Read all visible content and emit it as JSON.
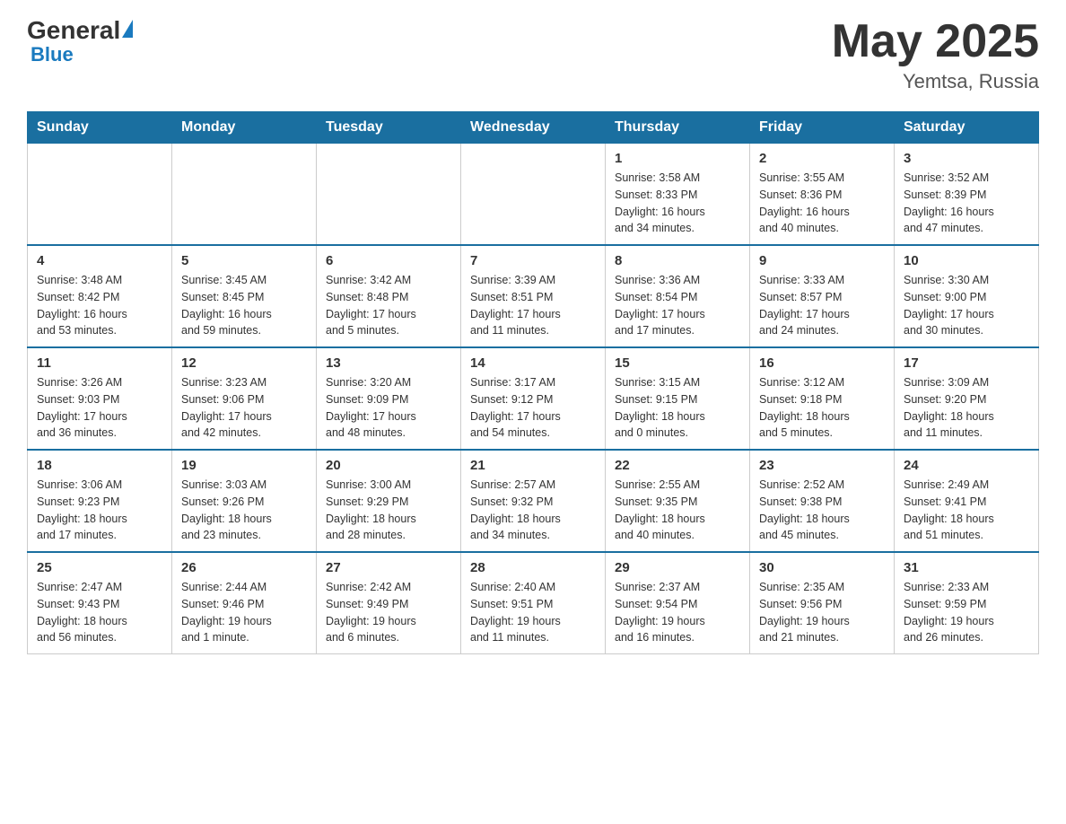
{
  "header": {
    "logo_general": "General",
    "logo_blue": "Blue",
    "month_year": "May 2025",
    "location": "Yemtsa, Russia"
  },
  "days_of_week": [
    "Sunday",
    "Monday",
    "Tuesday",
    "Wednesday",
    "Thursday",
    "Friday",
    "Saturday"
  ],
  "weeks": [
    [
      {
        "day": "",
        "info": ""
      },
      {
        "day": "",
        "info": ""
      },
      {
        "day": "",
        "info": ""
      },
      {
        "day": "",
        "info": ""
      },
      {
        "day": "1",
        "info": "Sunrise: 3:58 AM\nSunset: 8:33 PM\nDaylight: 16 hours\nand 34 minutes."
      },
      {
        "day": "2",
        "info": "Sunrise: 3:55 AM\nSunset: 8:36 PM\nDaylight: 16 hours\nand 40 minutes."
      },
      {
        "day": "3",
        "info": "Sunrise: 3:52 AM\nSunset: 8:39 PM\nDaylight: 16 hours\nand 47 minutes."
      }
    ],
    [
      {
        "day": "4",
        "info": "Sunrise: 3:48 AM\nSunset: 8:42 PM\nDaylight: 16 hours\nand 53 minutes."
      },
      {
        "day": "5",
        "info": "Sunrise: 3:45 AM\nSunset: 8:45 PM\nDaylight: 16 hours\nand 59 minutes."
      },
      {
        "day": "6",
        "info": "Sunrise: 3:42 AM\nSunset: 8:48 PM\nDaylight: 17 hours\nand 5 minutes."
      },
      {
        "day": "7",
        "info": "Sunrise: 3:39 AM\nSunset: 8:51 PM\nDaylight: 17 hours\nand 11 minutes."
      },
      {
        "day": "8",
        "info": "Sunrise: 3:36 AM\nSunset: 8:54 PM\nDaylight: 17 hours\nand 17 minutes."
      },
      {
        "day": "9",
        "info": "Sunrise: 3:33 AM\nSunset: 8:57 PM\nDaylight: 17 hours\nand 24 minutes."
      },
      {
        "day": "10",
        "info": "Sunrise: 3:30 AM\nSunset: 9:00 PM\nDaylight: 17 hours\nand 30 minutes."
      }
    ],
    [
      {
        "day": "11",
        "info": "Sunrise: 3:26 AM\nSunset: 9:03 PM\nDaylight: 17 hours\nand 36 minutes."
      },
      {
        "day": "12",
        "info": "Sunrise: 3:23 AM\nSunset: 9:06 PM\nDaylight: 17 hours\nand 42 minutes."
      },
      {
        "day": "13",
        "info": "Sunrise: 3:20 AM\nSunset: 9:09 PM\nDaylight: 17 hours\nand 48 minutes."
      },
      {
        "day": "14",
        "info": "Sunrise: 3:17 AM\nSunset: 9:12 PM\nDaylight: 17 hours\nand 54 minutes."
      },
      {
        "day": "15",
        "info": "Sunrise: 3:15 AM\nSunset: 9:15 PM\nDaylight: 18 hours\nand 0 minutes."
      },
      {
        "day": "16",
        "info": "Sunrise: 3:12 AM\nSunset: 9:18 PM\nDaylight: 18 hours\nand 5 minutes."
      },
      {
        "day": "17",
        "info": "Sunrise: 3:09 AM\nSunset: 9:20 PM\nDaylight: 18 hours\nand 11 minutes."
      }
    ],
    [
      {
        "day": "18",
        "info": "Sunrise: 3:06 AM\nSunset: 9:23 PM\nDaylight: 18 hours\nand 17 minutes."
      },
      {
        "day": "19",
        "info": "Sunrise: 3:03 AM\nSunset: 9:26 PM\nDaylight: 18 hours\nand 23 minutes."
      },
      {
        "day": "20",
        "info": "Sunrise: 3:00 AM\nSunset: 9:29 PM\nDaylight: 18 hours\nand 28 minutes."
      },
      {
        "day": "21",
        "info": "Sunrise: 2:57 AM\nSunset: 9:32 PM\nDaylight: 18 hours\nand 34 minutes."
      },
      {
        "day": "22",
        "info": "Sunrise: 2:55 AM\nSunset: 9:35 PM\nDaylight: 18 hours\nand 40 minutes."
      },
      {
        "day": "23",
        "info": "Sunrise: 2:52 AM\nSunset: 9:38 PM\nDaylight: 18 hours\nand 45 minutes."
      },
      {
        "day": "24",
        "info": "Sunrise: 2:49 AM\nSunset: 9:41 PM\nDaylight: 18 hours\nand 51 minutes."
      }
    ],
    [
      {
        "day": "25",
        "info": "Sunrise: 2:47 AM\nSunset: 9:43 PM\nDaylight: 18 hours\nand 56 minutes."
      },
      {
        "day": "26",
        "info": "Sunrise: 2:44 AM\nSunset: 9:46 PM\nDaylight: 19 hours\nand 1 minute."
      },
      {
        "day": "27",
        "info": "Sunrise: 2:42 AM\nSunset: 9:49 PM\nDaylight: 19 hours\nand 6 minutes."
      },
      {
        "day": "28",
        "info": "Sunrise: 2:40 AM\nSunset: 9:51 PM\nDaylight: 19 hours\nand 11 minutes."
      },
      {
        "day": "29",
        "info": "Sunrise: 2:37 AM\nSunset: 9:54 PM\nDaylight: 19 hours\nand 16 minutes."
      },
      {
        "day": "30",
        "info": "Sunrise: 2:35 AM\nSunset: 9:56 PM\nDaylight: 19 hours\nand 21 minutes."
      },
      {
        "day": "31",
        "info": "Sunrise: 2:33 AM\nSunset: 9:59 PM\nDaylight: 19 hours\nand 26 minutes."
      }
    ]
  ]
}
